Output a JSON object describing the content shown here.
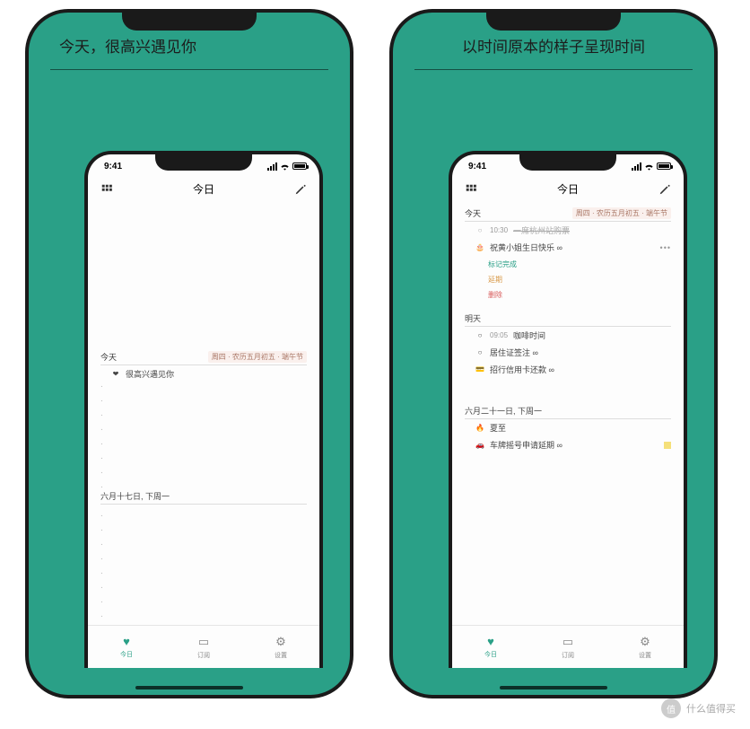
{
  "left": {
    "promo": "今天，很高兴遇见你",
    "status_time": "9:41",
    "header_title": "今日",
    "section_today": "今天",
    "lunar_date": "周四 · 农历五月初五 · 端午节",
    "greeting": "很高兴遇见你",
    "future_date": "六月十七日, 下周一"
  },
  "right": {
    "promo": "以时间原本的样子呈现时间",
    "status_time": "9:41",
    "header_title": "今日",
    "section_today": "今天",
    "lunar_date": "周四 · 农历五月初五 · 端午节",
    "item_ticket_time": "10:30",
    "item_ticket": "一席杭州站购票",
    "item_birthday": "祝黄小姐生日快乐 ∞",
    "action_done": "标记完成",
    "action_delay": "延期",
    "action_delete": "删除",
    "section_tomorrow": "明天",
    "item_coffee_time": "09:05",
    "item_coffee": "咖啡时间",
    "item_visa": "居住证签注 ∞",
    "item_card": "招行信用卡还款 ∞",
    "section_future": "六月二十一日, 下周一",
    "item_xiazhi": "夏至",
    "item_car": "车牌摇号申请延期 ∞"
  },
  "tabs": {
    "today": "今日",
    "subscribe": "订阅",
    "settings": "设置"
  },
  "watermark": "什么值得买"
}
